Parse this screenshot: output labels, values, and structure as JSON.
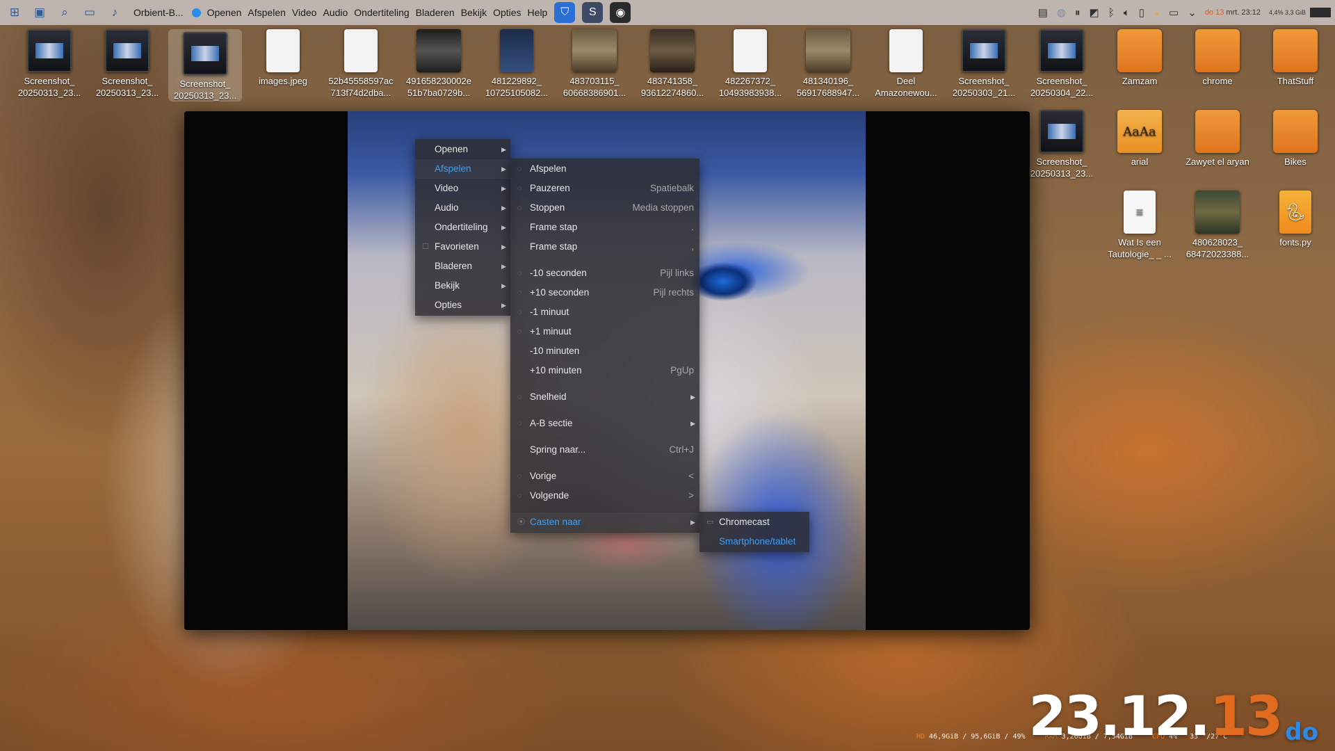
{
  "topbar": {
    "app_name": "Orbient-B...",
    "menus": [
      "Openen",
      "Afspelen",
      "Video",
      "Audio",
      "Ondertiteling",
      "Bladeren",
      "Bekijk",
      "Opties",
      "Help"
    ],
    "clock": {
      "prefix": "do",
      "day": "13",
      "rest": "mrt. 23:12"
    },
    "mini_stats": {
      "line1": "4,4%  3,3 GiB"
    }
  },
  "desktop": {
    "icons_row1": [
      {
        "label": "Screenshot_ 20250313_23...",
        "icon": "screenshot-thumb"
      },
      {
        "label": "Screenshot_ 20250313_23...",
        "icon": "screenshot-thumb"
      },
      {
        "label": "Screenshot_ 20250313_23...",
        "icon": "screenshot-thumb"
      },
      {
        "label": "images.jpeg",
        "icon": "image-thumb"
      },
      {
        "label": "52b45558597ac 713f74d2dba...",
        "icon": "document-thumb"
      },
      {
        "label": "4916582300​02e 51b7ba0729b...",
        "icon": "dark-image-thumb"
      },
      {
        "label": "481229892_ 10725105082...",
        "icon": "book-thumb"
      },
      {
        "label": "483703115_ 60668386901...",
        "icon": "photo-thumb"
      },
      {
        "label": "483741358_ 93612274860...",
        "icon": "photo-thumb"
      },
      {
        "label": "482267372_ 10493983938...",
        "icon": "document-thumb"
      },
      {
        "label": "481340196_ 56917688947...",
        "icon": "photo-thumb"
      },
      {
        "label": "Deel Amazonewou...",
        "icon": "document-thumb"
      },
      {
        "label": "Screenshot_ 20250303_21...",
        "icon": "screenshot-thumb"
      },
      {
        "label": "Screenshot_ 20250304_22...",
        "icon": "screenshot-thumb"
      },
      {
        "label": "Zamzam",
        "icon": "folder-icon"
      },
      {
        "label": "chrome",
        "icon": "folder-icon"
      },
      {
        "label": "ThatStuff",
        "icon": "folder-icon"
      }
    ],
    "icons_right": [
      {
        "label": "Screenshot_ 20250313_23...",
        "icon": "screenshot-thumb"
      },
      {
        "label": "arial",
        "icon": "font-folder-icon"
      },
      {
        "label": "Zawyet el aryan",
        "icon": "folder-icon"
      },
      {
        "label": "Bikes",
        "icon": "folder-icon"
      },
      {
        "label": "Wat Is een Tautologie_ _ ...",
        "icon": "text-file-icon"
      },
      {
        "label": "480628023_ 68472023388...",
        "icon": "photo-thumb"
      },
      {
        "label": "fonts.py",
        "icon": "python-file-icon"
      }
    ]
  },
  "menu_main": [
    {
      "label": "Openen"
    },
    {
      "label": "Afspelen",
      "active": true
    },
    {
      "label": "Video"
    },
    {
      "label": "Audio"
    },
    {
      "label": "Ondertiteling"
    },
    {
      "label": "Favorieten"
    },
    {
      "label": "Bladeren"
    },
    {
      "label": "Bekijk"
    },
    {
      "label": "Opties"
    }
  ],
  "menu_afspelen": {
    "items": [
      {
        "label": "Afspelen",
        "shortcut": ""
      },
      {
        "label": "Pauzeren",
        "shortcut": "Spatiebalk"
      },
      {
        "label": "Stoppen",
        "shortcut": "Media stoppen"
      },
      {
        "label": "Frame stap",
        "shortcut": "."
      },
      {
        "label": "Frame stap",
        "shortcut": ","
      },
      {
        "label": "-10 seconden",
        "shortcut": "Pijl links"
      },
      {
        "label": "+10 seconden",
        "shortcut": "Pijl rechts"
      },
      {
        "label": "-1 minuut",
        "shortcut": ""
      },
      {
        "label": "+1 minuut",
        "shortcut": ""
      },
      {
        "label": "-10 minuten",
        "shortcut": ""
      },
      {
        "label": "+10 minuten",
        "shortcut": "PgUp"
      },
      {
        "label": "Snelheid",
        "shortcut": ""
      },
      {
        "label": "A-B sectie",
        "shortcut": ""
      },
      {
        "label": "Spring naar...",
        "shortcut": "Ctrl+J"
      },
      {
        "label": "Vorige",
        "shortcut": "<"
      },
      {
        "label": "Volgende",
        "shortcut": ">"
      },
      {
        "label": "Casten naar",
        "shortcut": ""
      }
    ]
  },
  "menu_cast": [
    {
      "label": "Chromecast"
    },
    {
      "label": "Smartphone/tablet"
    }
  ],
  "stats": {
    "hd_label": "HD",
    "hd_value": "46,9GiB / 95,6GiB / 49%",
    "ram_label": "RAM",
    "ram_value": "3,26GiB / 7,54GiB",
    "cpu_label": "CPU",
    "cpu_value": "4%",
    "temp_value": "33 °/27°C"
  },
  "big_date": {
    "main": "23.12.",
    "minute": "13",
    "day": "do"
  },
  "colors": {
    "accent_blue": "#3ea0f5",
    "accent_orange": "#e06a1e"
  }
}
